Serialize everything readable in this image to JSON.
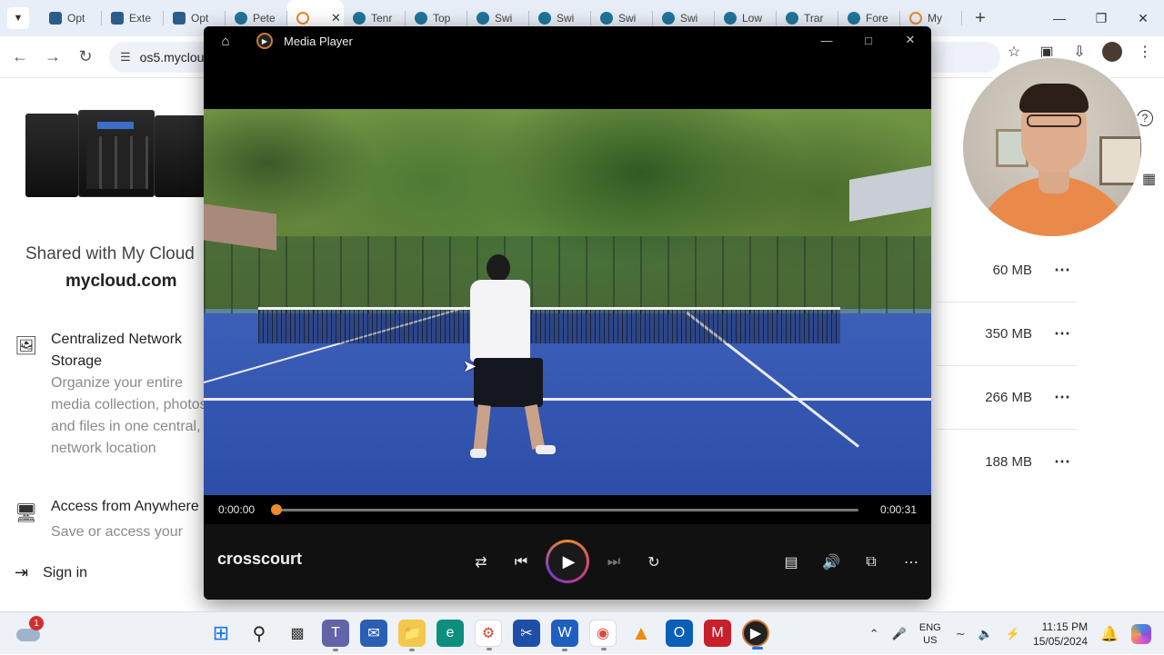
{
  "browser": {
    "tabs": [
      {
        "label": "Opt",
        "favicon": "sport"
      },
      {
        "label": "Exte",
        "favicon": "sport"
      },
      {
        "label": "Opt",
        "favicon": "sport"
      },
      {
        "label": "Pete",
        "favicon": "wp"
      },
      {
        "label": "",
        "favicon": "wd",
        "active": true
      },
      {
        "label": "Tenr",
        "favicon": "wp"
      },
      {
        "label": "Top",
        "favicon": "wp"
      },
      {
        "label": "Swi",
        "favicon": "wp"
      },
      {
        "label": "Swi",
        "favicon": "wp"
      },
      {
        "label": "Swi",
        "favicon": "wp"
      },
      {
        "label": "Swi",
        "favicon": "wp"
      },
      {
        "label": "Low",
        "favicon": "wp"
      },
      {
        "label": "Trar",
        "favicon": "wp"
      },
      {
        "label": "Fore",
        "favicon": "wp"
      },
      {
        "label": "My",
        "favicon": "wd"
      }
    ],
    "url": "os5.myclou"
  },
  "page": {
    "shared_title": "Shared with My Cloud",
    "shared_site": "mycloud.com",
    "features": [
      {
        "title": "Centralized Network Storage",
        "desc": "Organize your entire media collection, photos and files in one central, network location",
        "icon": "network-storage-icon"
      },
      {
        "title": "Access from Anywhere",
        "desc": "Save or access your",
        "icon": "remote-access-icon"
      }
    ],
    "signin_label": "Sign in",
    "file_sizes": [
      "60 MB",
      "350 MB",
      "266 MB",
      "188 MB"
    ],
    "help_label": "?"
  },
  "media_player": {
    "title": "Media Player",
    "current_time": "0:00:00",
    "total_time": "0:00:31",
    "progress": 0,
    "now_playing": "crosscourt",
    "accent_color": "#f08a2a"
  },
  "taskbar": {
    "weather_badge": "1",
    "lang_line1": "ENG",
    "lang_line2": "US",
    "time": "11:15 PM",
    "date": "15/05/2024"
  }
}
